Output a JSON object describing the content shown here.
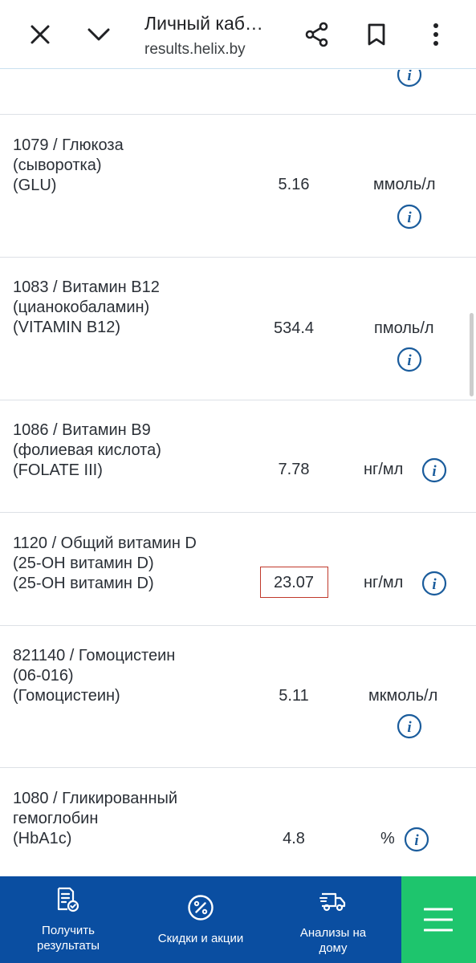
{
  "browser": {
    "title": "Личный каб…",
    "url": "results.helix.by"
  },
  "results": [
    {
      "name_lines": [
        "1079 / Глюкоза",
        "(сыворотка)",
        "(GLU)"
      ],
      "value": "5.16",
      "unit": "ммоль/л",
      "highlighted": false
    },
    {
      "name_lines": [
        "1083 / Витамин B12",
        "(цианокобаламин)",
        "(VITAMIN B12)"
      ],
      "value": "534.4",
      "unit": "пмоль/л",
      "highlighted": false
    },
    {
      "name_lines": [
        "1086 / Витамин B9",
        "(фолиевая кислота)",
        "(FOLATE III)"
      ],
      "value": "7.78",
      "unit": "нг/мл",
      "highlighted": false
    },
    {
      "name_lines": [
        "1120 / Общий витамин D",
        "(25-OH витамин D)",
        "(25-OH витамин D)"
      ],
      "value": "23.07",
      "unit": "нг/мл",
      "highlighted": true
    },
    {
      "name_lines": [
        "821140 / Гомоцистеин",
        "(06-016)",
        "(Гомоцистеин)"
      ],
      "value": "5.11",
      "unit": "мкмоль/л",
      "highlighted": false
    },
    {
      "name_lines": [
        "1080 / Гликированный",
        "гемоглобин",
        "(HbA1c)"
      ],
      "value": "4.8",
      "unit": "%",
      "highlighted": false
    }
  ],
  "bottom_nav": {
    "items": [
      {
        "label": "Получить\nрезультаты",
        "icon": "document-check-icon"
      },
      {
        "label": "Скидки и акции",
        "icon": "percent-icon"
      },
      {
        "label": "Анализы на\nдому",
        "icon": "delivery-truck-icon"
      }
    ],
    "menu_icon": "hamburger-menu-icon"
  },
  "colors": {
    "nav_background": "#0a4ea1",
    "menu_background": "#1ec56d",
    "info_icon": "#1a5c9c",
    "highlight_border": "#c0392b"
  }
}
